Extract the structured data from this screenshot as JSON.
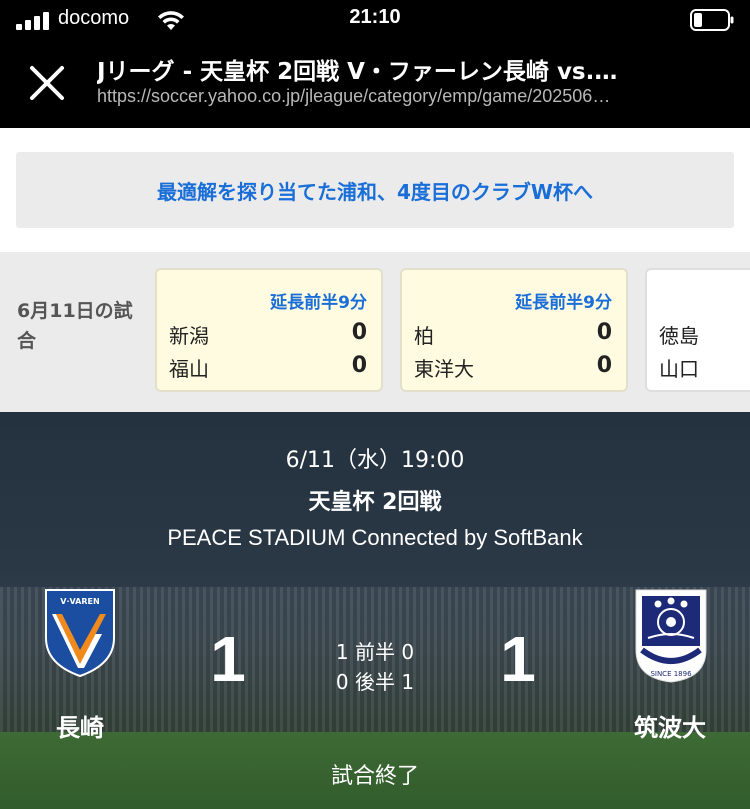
{
  "status_bar": {
    "carrier": "docomo",
    "time": "21:10"
  },
  "browser": {
    "title": "Jリーグ - 天皇杯 2回戦 V・ファーレン長崎 vs.…",
    "url": "https://soccer.yahoo.co.jp/jleague/category/emp/game/202506…"
  },
  "headline": {
    "text": "最適解を探り当てた浦和、4度目のクラブW杯へ",
    "color": "#1a6ed8"
  },
  "other_matches": {
    "day_label": "6月11日の試合",
    "cards": [
      {
        "status": "延長前半9分",
        "home": "新潟",
        "home_score": "0",
        "away": "福山",
        "away_score": "0"
      },
      {
        "status": "延長前半9分",
        "home": "柏",
        "home_score": "0",
        "away": "東洋大",
        "away_score": "0"
      },
      {
        "status": "",
        "home": "徳島",
        "home_score": "",
        "away": "山口",
        "away_score": ""
      }
    ]
  },
  "match": {
    "datetime": "6/11（水）19:00",
    "competition": "天皇杯 2回戦",
    "venue": "PEACE STADIUM Connected by SoftBank",
    "home_team": "長崎",
    "away_team": "筑波大",
    "home_score": "1",
    "away_score": "1",
    "first_half": "1 前半 0",
    "second_half": "0 後半 1",
    "status": "試合終了",
    "home_emblem_text": "V·VAREN",
    "away_emblem_text": "SINCE 1896"
  }
}
